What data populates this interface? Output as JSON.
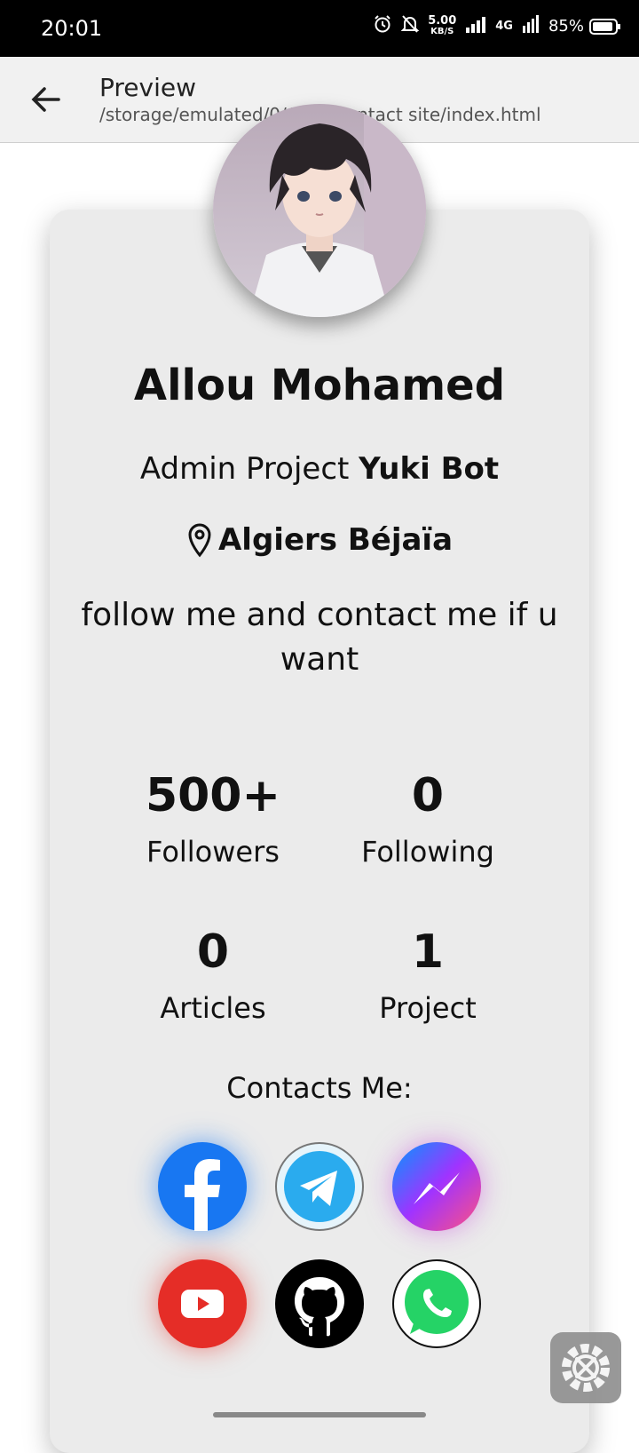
{
  "status_bar": {
    "time": "20:01",
    "net_speed_value": "5.00",
    "net_speed_unit": "KB/S",
    "network": "4G",
    "battery": "85%"
  },
  "app_bar": {
    "title": "Preview",
    "path": "/storage/emulated/0/Allou contact site/index.html"
  },
  "profile": {
    "name": "Allou Mohamed",
    "role_prefix": "Admin Project",
    "role_project": "Yuki Bot",
    "location": "Algiers Béjaïa",
    "bio": "follow me and contact me if u want"
  },
  "stats": [
    {
      "value": "500+",
      "label": "Followers"
    },
    {
      "value": "0",
      "label": "Following"
    },
    {
      "value": "0",
      "label": "Articles"
    },
    {
      "value": "1",
      "label": "Project"
    }
  ],
  "contacts": {
    "heading": "Contacts Me:",
    "items": [
      {
        "name": "facebook",
        "color": "#1877F2"
      },
      {
        "name": "telegram",
        "color": "#2AABEE"
      },
      {
        "name": "messenger",
        "color": "#A033FF"
      },
      {
        "name": "youtube",
        "color": "#E52D27"
      },
      {
        "name": "github",
        "color": "#000000"
      },
      {
        "name": "whatsapp",
        "color": "#25D366"
      }
    ]
  }
}
